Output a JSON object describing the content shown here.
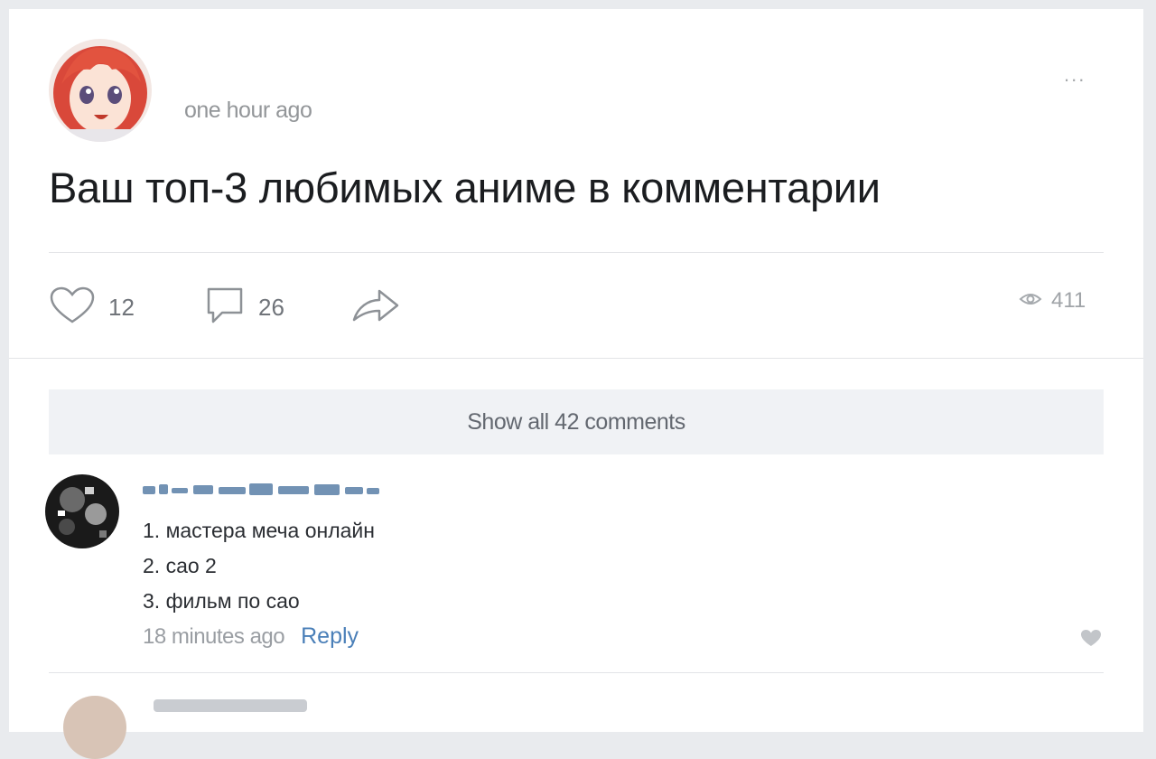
{
  "post": {
    "time": "one hour ago",
    "more_label": "...",
    "text": "Ваш топ-3 любимых аниме в комментарии",
    "likes": "12",
    "comments": "26",
    "views": "411"
  },
  "show_all_label": "Show all 42 comments",
  "comment": {
    "lines": [
      "1. мастера меча онлайн",
      "2. сао 2",
      "3. фильм по сао"
    ],
    "time": "18 minutes ago",
    "reply_label": "Reply"
  },
  "colors": {
    "accent_link": "#4a7fb8",
    "muted_text": "#939699",
    "panel_bg": "#f0f2f5"
  },
  "icons": [
    "heart-icon",
    "comment-icon",
    "share-icon",
    "eye-icon",
    "small-heart-icon",
    "more-dots-icon"
  ]
}
